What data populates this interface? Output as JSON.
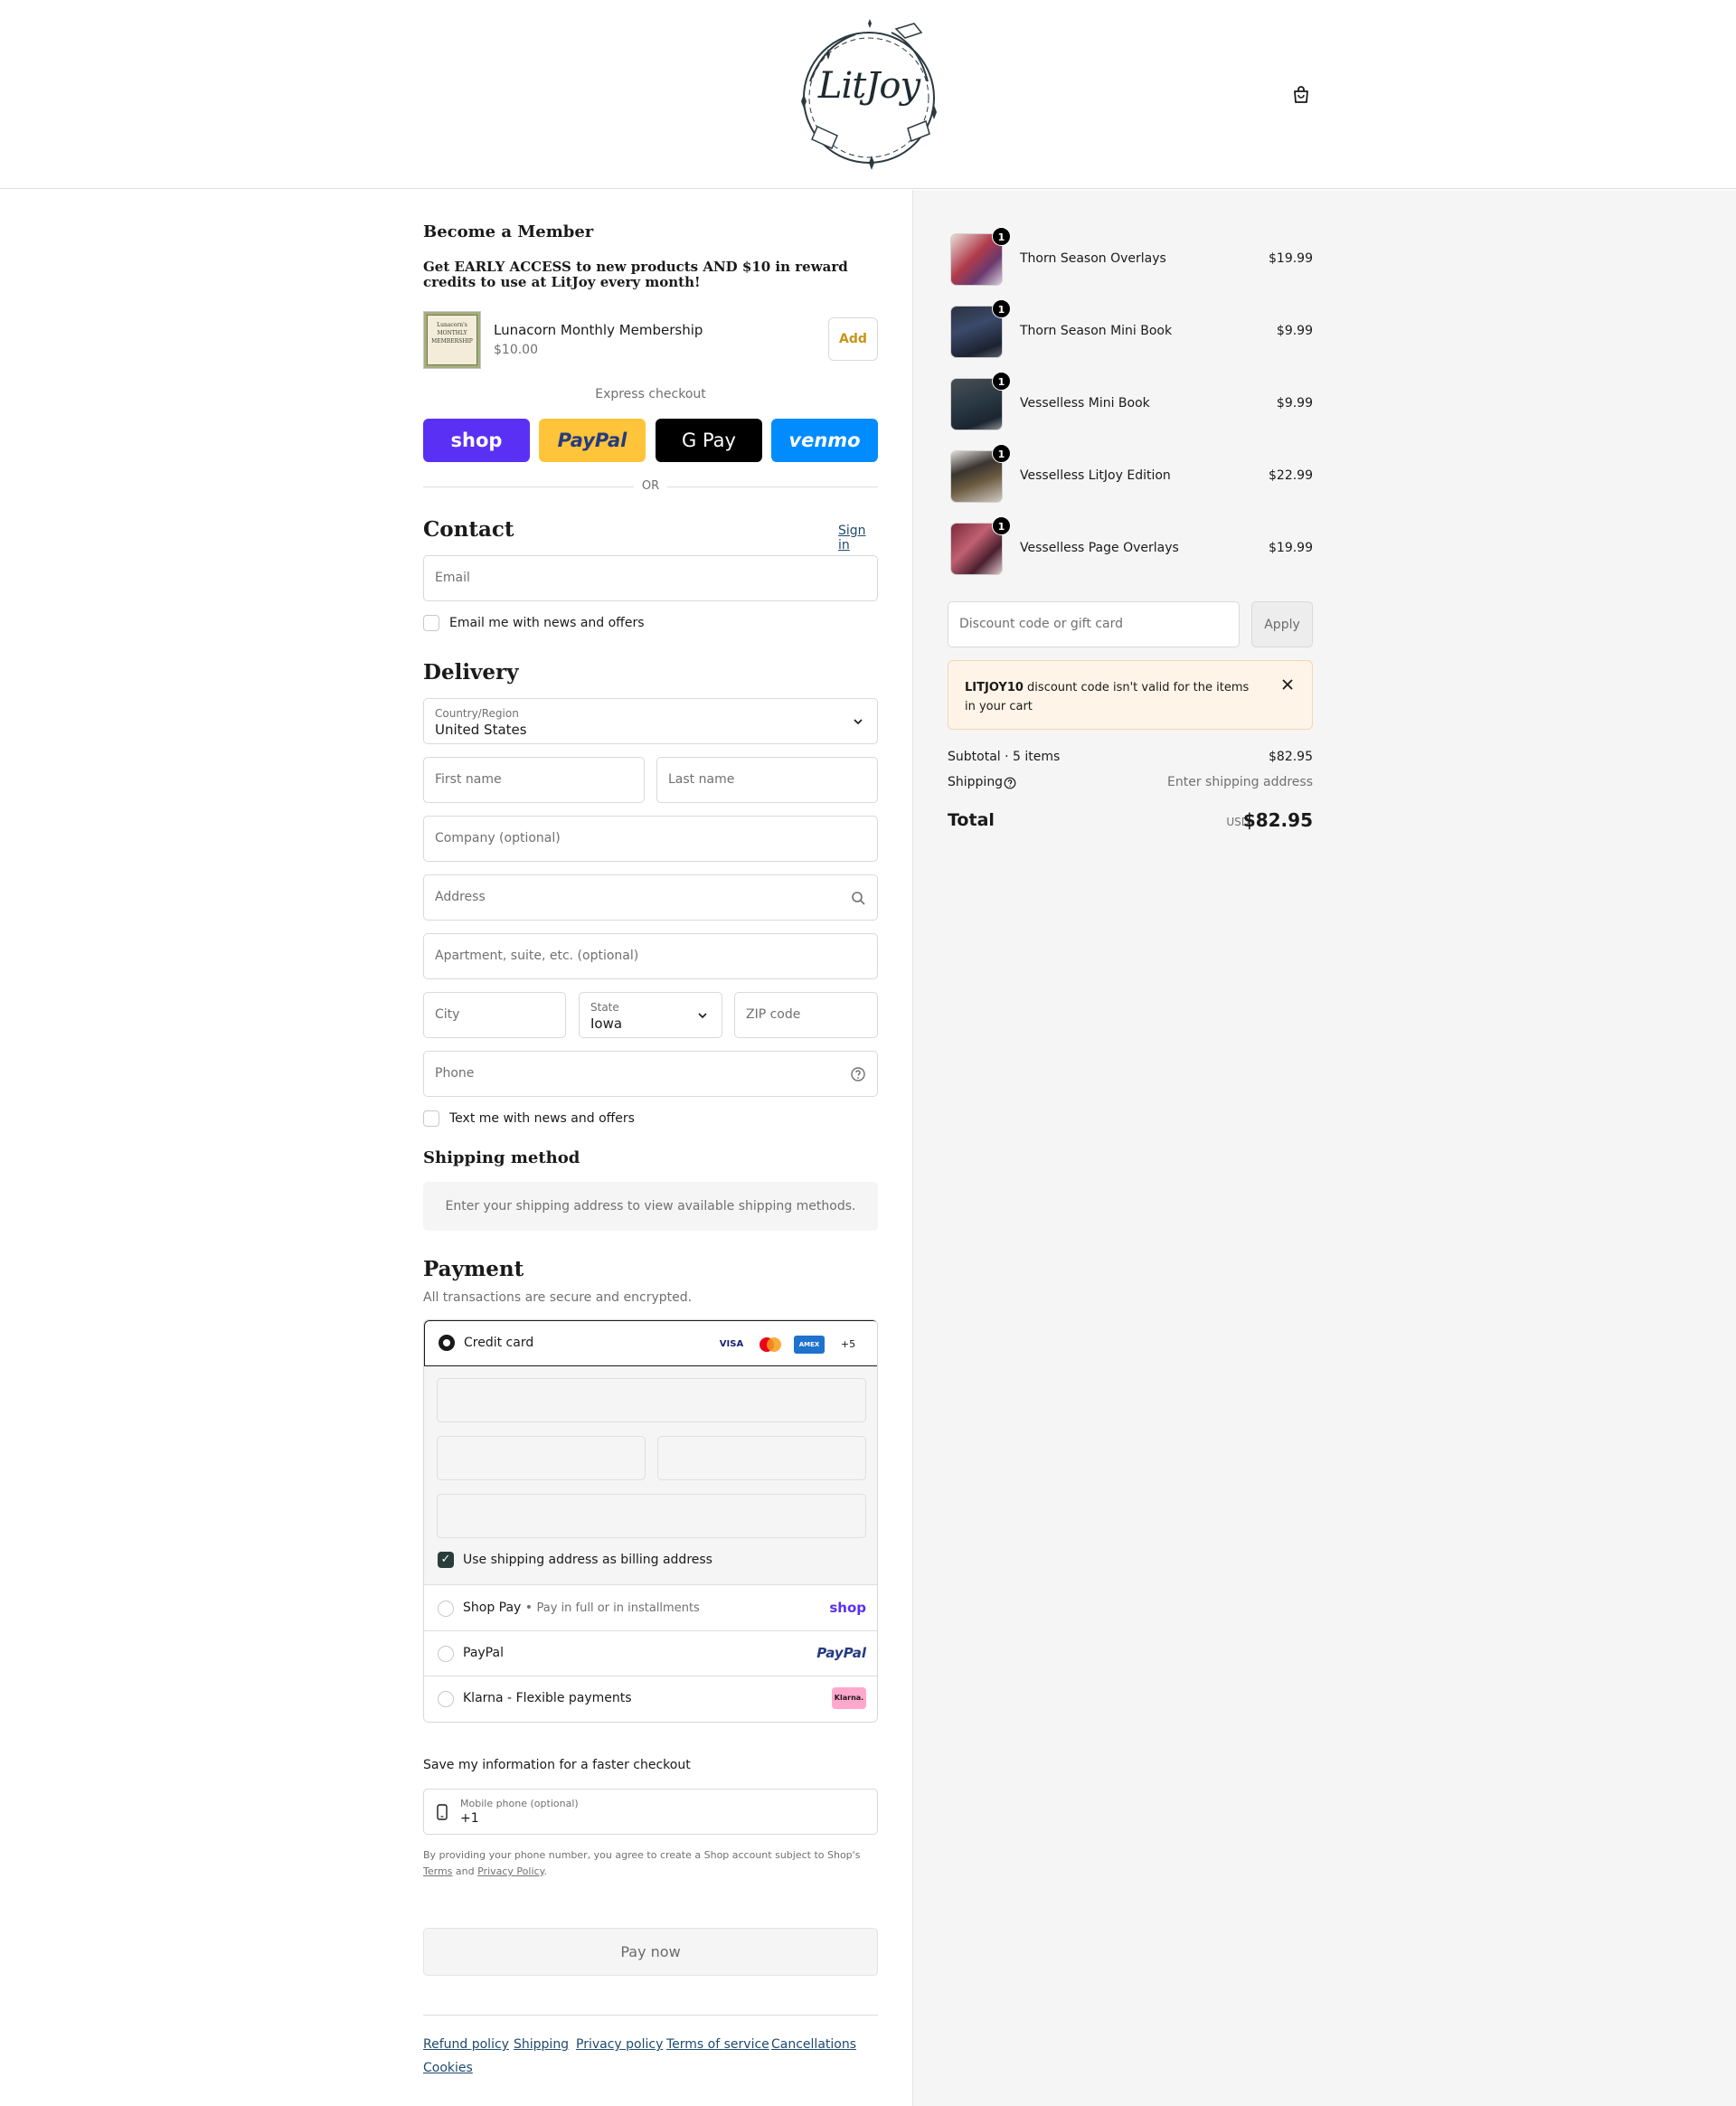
{
  "header": {
    "logo_text": "LitJoy",
    "cart_icon": "shopping-bag-icon"
  },
  "member": {
    "title": "Become a Member",
    "subtitle": "Get EARLY ACCESS to new products AND $10 in reward credits to use at LitJoy every month!",
    "product_name": "Lunacorn Monthly Membership",
    "product_price": "$10.00",
    "add_label": "Add",
    "image_text": "Lunacorn's MONTHLY MEMBERSHIP"
  },
  "express": {
    "label": "Express checkout",
    "shop_label": "shop",
    "paypal_label": "PayPal",
    "gpay_label": "G Pay",
    "venmo_label": "venmo",
    "or_label": "OR"
  },
  "contact": {
    "title": "Contact",
    "sign_in": "Sign in",
    "email_placeholder": "Email",
    "news_label": "Email me with news and offers"
  },
  "delivery": {
    "title": "Delivery",
    "country_label": "Country/Region",
    "country_value": "United States",
    "first_name": "First name",
    "last_name": "Last name",
    "company": "Company (optional)",
    "address": "Address",
    "apartment": "Apartment, suite, etc. (optional)",
    "city": "City",
    "state_label": "State",
    "state_value": "Iowa",
    "zip": "ZIP code",
    "phone": "Phone",
    "text_label": "Text me with news and offers"
  },
  "shipping": {
    "title": "Shipping method",
    "message": "Enter your shipping address to view available shipping methods."
  },
  "payment": {
    "title": "Payment",
    "subtitle": "All transactions are secure and encrypted.",
    "credit_card": "Credit card",
    "cards": [
      "VISA",
      "MC",
      "AMEX",
      "+5"
    ],
    "billing_label": "Use shipping address as billing address",
    "shop_pay": "Shop Pay",
    "shop_pay_note": "Pay in full or in installments",
    "shop_pay_logo": "shop",
    "paypal": "PayPal",
    "paypal_logo": "PayPal",
    "klarna": "Klarna - Flexible payments",
    "klarna_logo": "Klarna."
  },
  "save": {
    "title": "Save my information for a faster checkout",
    "phone_label": "Mobile phone (optional)",
    "phone_value": "+1",
    "fine_print": "By providing your phone number, you agree to create a Shop account subject to Shop's",
    "terms": "Terms",
    "and": "and",
    "privacy": "Privacy Policy",
    "period": "."
  },
  "pay_now": "Pay now",
  "footer": [
    "Refund policy",
    "Shipping",
    "Privacy policy",
    "Terms of service",
    "Cancellations",
    "Cookies"
  ],
  "summary": {
    "items": [
      {
        "name": "Thorn Season Overlays",
        "price": "$19.99",
        "qty": "1"
      },
      {
        "name": "Thorn Season Mini Book",
        "price": "$9.99",
        "qty": "1"
      },
      {
        "name": "Vesselless Mini Book",
        "price": "$9.99",
        "qty": "1"
      },
      {
        "name": "Vesselless LitJoy Edition",
        "price": "$22.99",
        "qty": "1"
      },
      {
        "name": "Vesselless Page Overlays",
        "price": "$19.99",
        "qty": "1"
      }
    ],
    "discount_placeholder": "Discount code or gift card",
    "apply": "Apply",
    "alert_code": "LITJOY10",
    "alert_text": " discount code isn't valid for the items in your cart",
    "subtotal_label": "Subtotal · 5 items",
    "subtotal_value": "$82.95",
    "shipping_label": "Shipping",
    "shipping_value": "Enter shipping address",
    "total_label": "Total",
    "currency": "USD",
    "total_value": "$82.95"
  },
  "colors": {
    "accent": "#c99419",
    "link": "#1e4a6e",
    "shop_purple": "#5a31f4",
    "paypal_yellow": "#ffc439",
    "venmo_blue": "#008cff",
    "alert_bg": "#fff4e7"
  }
}
